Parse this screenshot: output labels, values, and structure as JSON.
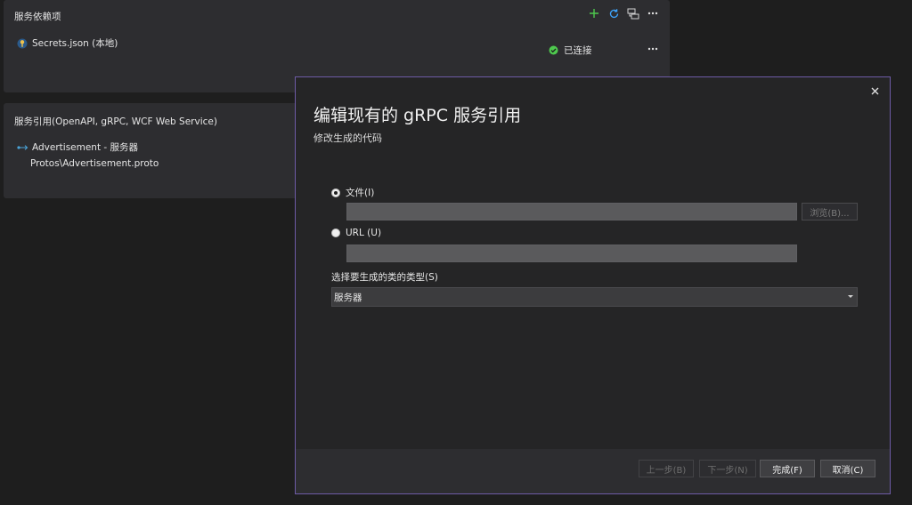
{
  "dependencies": {
    "title": "服务依赖项",
    "item_label": "Secrets.json (本地)",
    "status_label": "已连接"
  },
  "references": {
    "title": "服务引用(OpenAPI, gRPC, WCF Web Service)",
    "item_label": "Advertisement - 服务器",
    "item_path": "Protos\\Advertisement.proto"
  },
  "dialog": {
    "title": "编辑现有的 gRPC 服务引用",
    "subtitle": "修改生成的代码",
    "file_option_label": "文件(I)",
    "file_value": "",
    "browse_label": "浏览(B)...",
    "url_option_label": "URL (U)",
    "url_value": "",
    "class_type_label": "选择要生成的类的类型(S)",
    "class_type_selected": "服务器",
    "back_label": "上一步(B)",
    "next_label": "下一步(N)",
    "finish_label": "完成(F)",
    "cancel_label": "取消(C)"
  },
  "colors": {
    "accent_green": "#4ec94e",
    "refresh_blue": "#3ea6ff",
    "dialog_border": "#6e5ba6"
  }
}
